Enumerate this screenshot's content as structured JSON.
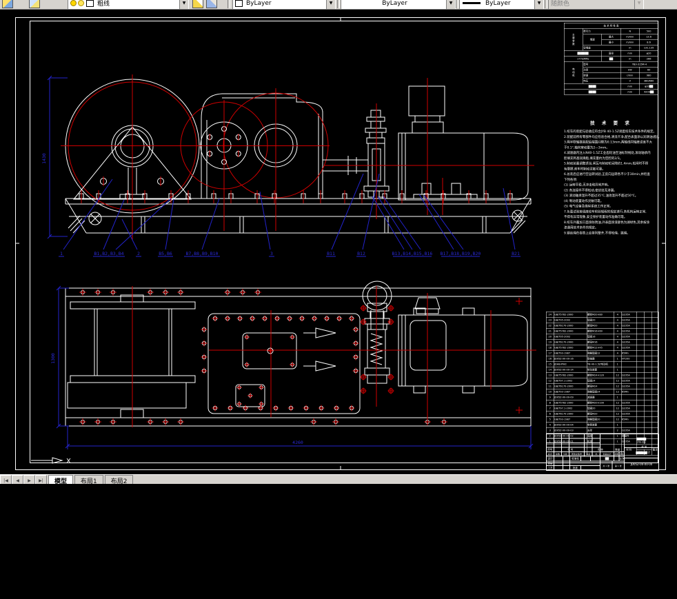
{
  "toolbar": {
    "layer_combo": {
      "layer_name": "粗线"
    },
    "color_combo": {
      "value": "ByLayer"
    },
    "linetype_combo": {
      "value": "ByLayer"
    },
    "lineweight_combo": {
      "value": "ByLayer"
    },
    "plotstyle_combo": {
      "value": "随颜色"
    }
  },
  "tabs": {
    "nav": [
      "|◀",
      "◀",
      "▶",
      "▶|"
    ],
    "model": "模型",
    "layout1": "布局1",
    "layout2": "布局2"
  },
  "ucs": {
    "x_label": "X"
  },
  "front_view": {
    "dim_height": "1430",
    "labels": [
      {
        "text": "1"
      },
      {
        "text": "B1,B2,B3,B4"
      },
      {
        "text": "2"
      },
      {
        "text": "B5,B6"
      },
      {
        "text": "B7,B8,B9,B10"
      },
      {
        "text": "3"
      },
      {
        "text": "B11"
      },
      {
        "text": "B12"
      },
      {
        "text": "B13,B14,B15,B16"
      },
      {
        "text": "B17,B18,B19,B20"
      },
      {
        "text": "B21"
      }
    ]
  },
  "plan_view": {
    "dim_height": "1300",
    "dim_width": "4260"
  },
  "spec_table": {
    "rows": [
      [
        {
          "t": "技 术 特 性 表",
          "cs": 5,
          "cls": "c"
        }
      ],
      [
        {
          "t": "主要参数",
          "rs": 4,
          "cls": "vert"
        },
        {
          "t": "牵引力",
          "cs": 2
        },
        {
          "t": "N",
          "cls": "c"
        },
        {
          "t": "500",
          "cls": "c"
        }
      ],
      [
        {
          "t": "绳速",
          "rs": 2,
          "cls": "c"
        },
        {
          "t": "最大",
          "cls": "c"
        },
        {
          "t": "m/min",
          "cls": "c"
        },
        {
          "t": "13.6",
          "cls": "c"
        }
      ],
      [
        {
          "t": "最小",
          "cls": "c"
        },
        {
          "t": "m/min",
          "cls": "c"
        },
        {
          "t": "8.6",
          "cls": "c"
        }
      ],
      [
        {
          "t": "容绳量",
          "cs": 2
        },
        {
          "t": "m",
          "cls": "c"
        },
        {
          "t": "131.135",
          "cls": "c"
        }
      ],
      [
        {
          "t": "██████",
          "cs": 2,
          "rs": 1,
          "cls": "c"
        },
        {
          "t": "直径",
          "cls": "c"
        },
        {
          "t": "mm",
          "cls": "c"
        },
        {
          "t": "φ20",
          "cls": "c"
        }
      ],
      [
        {
          "t": "177k/MPa",
          "cs": 2,
          "cls": "c"
        },
        {
          "t": "██",
          "cls": "c"
        },
        {
          "t": "m",
          "cls": "c"
        },
        {
          "t": "266",
          "cls": "c"
        }
      ],
      [
        {
          "t": "电动机",
          "rs": 4,
          "cls": "vert"
        },
        {
          "t": "型号",
          "cs": 2
        },
        {
          "t": "YB3-315M-4",
          "cs": 2,
          "cls": "c"
        }
      ],
      [
        {
          "t": "功率",
          "cs": 2
        },
        {
          "t": "kW",
          "cls": "c"
        },
        {
          "t": "60",
          "cls": "c"
        }
      ],
      [
        {
          "t": "转速",
          "cs": 2
        },
        {
          "t": "r/min",
          "cls": "c"
        },
        {
          "t": "980",
          "cls": "c"
        }
      ],
      [
        {
          "t": "电压",
          "cs": 2
        },
        {
          "t": "V",
          "cls": "c"
        },
        {
          "t": "380/660",
          "cls": "c"
        }
      ],
      [
        {
          "t": "████",
          "cs": 3,
          "cls": "c"
        },
        {
          "t": "mm",
          "cls": "c"
        },
        {
          "t": "φ20██",
          "cls": "c"
        }
      ],
      [
        {
          "t": "████",
          "cs": 3,
          "cls": "c"
        },
        {
          "t": "mm",
          "cls": "c"
        },
        {
          "t": "4200██",
          "cls": "c"
        }
      ]
    ]
  },
  "tech_requirements": {
    "title": "技 术 要 求",
    "lines": [
      "1.绞车的装配与验收应符合JYB 40-1.5Z调度绞车技术条件的规定。",
      "2.装配前所有零部件均应检验合格,清洗干净,配合表面涂以润滑油(脂)。",
      "3.两半联轴器装配后端面间隙为0.13mm,两轴线同轴度误差不大",
      "  于0.1°,轴向窜动量为2—3mm。",
      "4.减速器内注入N40-1.5Z工业齿轮油至油标刻线处,滚动轴承内",
      "  腔填充钙基润滑脂,填充量约为空腔的2/3。",
      "5.制动装置调整适当,闸瓦与制动轮间隙约1.4mm,松闸时不得",
      "  有摩擦,刹车时制动灵敏可靠。",
      "6.总装后应进行空运转试验,正反向运转各不少于30min,并检查",
      "  下列各项:",
      "  (1) 运转平稳,无冲击和异常声响。",
      "  (2) 各连接件不得松动,密封处无渗漏。",
      "  (3) 滚动轴承温升不超过35℃,油池温升不超过50℃。",
      "  (4) 制动装置动作灵敏可靠。",
      "  (5) 电气设备及操纵系统工作正常。",
      "7.负载试验按调度绞车检验规程的规定进行,各机构运转正常,",
      "  不得有异常现象,安全保护装置动作准确可靠。",
      "8.绞车外露加工面涂防锈油,外表面涂漆颜色为湖绿色,其余按涂",
      "  漆通用技术条件的规定。",
      "9.钢丝绳在卷筒上应排列整齐,不得咬绳、跳绳。"
    ]
  },
  "parts_list": {
    "header": [
      "序号",
      "代 号",
      "名 称",
      "数量",
      "材 料",
      "单件",
      "总计",
      "备注"
    ],
    "weight_label": "重 量",
    "rows": [
      [
        "24",
        "GB/T5782-2000",
        "螺栓M20×80",
        "4",
        "Q235A",
        "",
        "",
        ""
      ],
      [
        "23",
        "GB/T95-2002",
        "垫圈20",
        "4",
        "Q235A",
        "",
        "",
        ""
      ],
      [
        "22",
        "GB/T6170-2000",
        "螺母M20",
        "4",
        "Q235A",
        "",
        "",
        ""
      ],
      [
        "21",
        "GB/T5782-2000",
        "螺栓M16×60",
        "4",
        "Q235A",
        "",
        "",
        ""
      ],
      [
        "20",
        "GB/T95-2002",
        "垫圈16",
        "4",
        "Q235A",
        "",
        "",
        ""
      ],
      [
        "19",
        "GB/T6170-2000",
        "螺母M16",
        "4",
        "Q235A",
        "",
        "",
        ""
      ],
      [
        "18",
        "GB/T5782-2000",
        "螺栓M12×45",
        "4",
        "Q235A",
        "",
        "",
        ""
      ],
      [
        "17",
        "GB/T93-1987",
        "弹簧垫圈12",
        "4",
        "65Mn",
        "",
        "",
        ""
      ],
      [
        "16",
        "JD05Z-00-00-16",
        "联轴器",
        "1",
        "HT200",
        "",
        "",
        ""
      ],
      [
        "15",
        "JDHB-PW2",
        "YB 40-1.5Z电动机",
        "1",
        "",
        "",
        "",
        ""
      ],
      [
        "14",
        "JD05Z-00-00-14",
        "制动装置",
        "1",
        "",
        "",
        "",
        ""
      ],
      [
        "13",
        "GB/T5782-2000",
        "螺栓M24×120",
        "12",
        "Q235A",
        "",
        "",
        ""
      ],
      [
        "12",
        "GB/T97.1-2002",
        "垫圈24",
        "12",
        "Q235A",
        "",
        "",
        ""
      ],
      [
        "11",
        "GB/T6170-2000",
        "螺母M24",
        "12",
        "Q235A",
        "",
        "",
        ""
      ],
      [
        "10",
        "GB/T93-1987",
        "弹簧垫圈24",
        "12",
        "65Mn",
        "",
        "",
        ""
      ],
      [
        "9",
        "JD05Z-00-00-09",
        "减速器",
        "1",
        "",
        "",
        "",
        ""
      ],
      [
        "8",
        "GB/T5782-2000",
        "螺栓M20×100",
        "12",
        "Q235A",
        "",
        "",
        ""
      ],
      [
        "7",
        "GB/T97.1-2002",
        "垫圈20",
        "12",
        "Q235A",
        "",
        "",
        ""
      ],
      [
        "6",
        "GB/T6170-2000",
        "螺母M20",
        "12",
        "Q235A",
        "",
        "",
        ""
      ],
      [
        "5",
        "GB/T93-1987",
        "弹簧垫圈20",
        "12",
        "65Mn",
        "",
        "",
        ""
      ],
      [
        "4",
        "JD05Z-00-00-04",
        "卷筒装置",
        "1",
        "",
        "",
        "",
        ""
      ],
      [
        "3",
        "JD05Z-00-00-03",
        "支架",
        "2",
        "Q235A",
        "",
        "",
        ""
      ],
      [
        "2",
        "JD05Z-00-00-02",
        "底座",
        "1",
        "焊接件",
        "",
        "",
        ""
      ],
      [
        "1",
        "JD05Z-00-00-01",
        "机架",
        "1",
        "Q235A",
        "",
        "",
        ""
      ]
    ]
  },
  "title_block": {
    "mark": "标记",
    "count": "处数",
    "zone": "分区",
    "change_doc": "更改文件号",
    "sign": "签名",
    "date": "年、月、日",
    "design": "设计",
    "check": "审核",
    "process": "工艺",
    "standard": "标准化",
    "approve": "批准",
    "stage_mark": "阶段标记",
    "weight": "质量",
    "scale_label": "比例",
    "scale": "1:5",
    "sheets": "共 1 张",
    "sheet_no": "第 1 张",
    "product_block": "█████",
    "product_model": "JYB-3型",
    "subtitle_block": "██████",
    "drawing_no": "JD05Z-00-00-00"
  }
}
